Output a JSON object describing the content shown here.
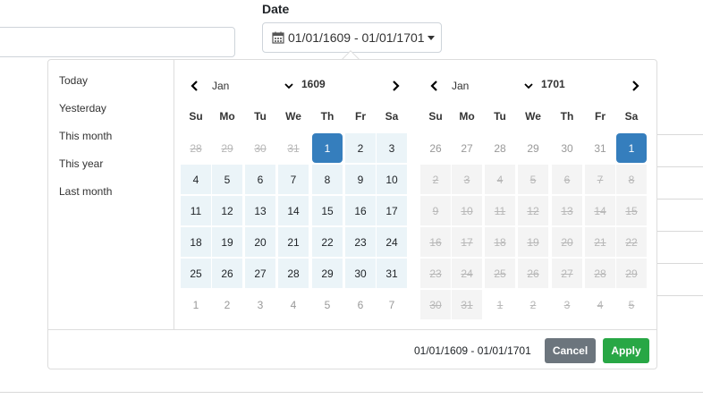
{
  "filter": {
    "date_label": "Date",
    "date_value": "01/01/1609 - 01/01/1701"
  },
  "ranges": [
    "Today",
    "Yesterday",
    "This month",
    "This year",
    "Last month"
  ],
  "left_calendar": {
    "month": "Jan",
    "year": "1609",
    "weekdays": [
      "Su",
      "Mo",
      "Tu",
      "We",
      "Th",
      "Fr",
      "Sa"
    ],
    "days": [
      [
        "28",
        "29",
        "30",
        "31",
        "1",
        "2",
        "3"
      ],
      [
        "4",
        "5",
        "6",
        "7",
        "8",
        "9",
        "10"
      ],
      [
        "11",
        "12",
        "13",
        "14",
        "15",
        "16",
        "17"
      ],
      [
        "18",
        "19",
        "20",
        "21",
        "22",
        "23",
        "24"
      ],
      [
        "25",
        "26",
        "27",
        "28",
        "29",
        "30",
        "31"
      ],
      [
        "1",
        "2",
        "3",
        "4",
        "5",
        "6",
        "7"
      ]
    ]
  },
  "right_calendar": {
    "month": "Jan",
    "year": "1701",
    "weekdays": [
      "Su",
      "Mo",
      "Tu",
      "We",
      "Th",
      "Fr",
      "Sa"
    ],
    "days": [
      [
        "26",
        "27",
        "28",
        "29",
        "30",
        "31",
        "1"
      ],
      [
        "2",
        "3",
        "4",
        "5",
        "6",
        "7",
        "8"
      ],
      [
        "9",
        "10",
        "11",
        "12",
        "13",
        "14",
        "15"
      ],
      [
        "16",
        "17",
        "18",
        "19",
        "20",
        "21",
        "22"
      ],
      [
        "23",
        "24",
        "25",
        "26",
        "27",
        "28",
        "29"
      ],
      [
        "30",
        "31",
        "1",
        "2",
        "3",
        "4",
        "5"
      ]
    ]
  },
  "footer": {
    "selected_range": "01/01/1609 - 01/01/1701",
    "cancel_label": "Cancel",
    "apply_label": "Apply"
  },
  "colors": {
    "active": "#357ebd",
    "in_range": "#ebf4f8",
    "cancel": "#6c757d",
    "apply": "#28a745"
  },
  "icons": [
    "calendar-icon",
    "caret-down-icon",
    "chevron-left-icon",
    "chevron-right-icon",
    "chevron-down-icon"
  ]
}
